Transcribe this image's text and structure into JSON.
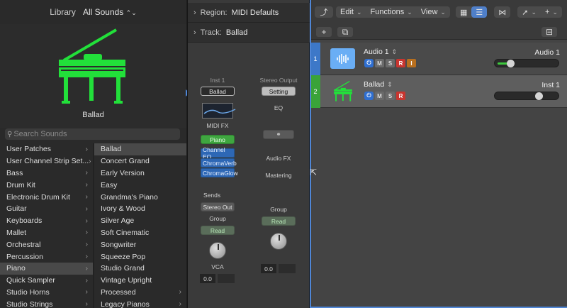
{
  "library": {
    "title": "Library",
    "selector": "All Sounds",
    "patch_name": "Ballad",
    "search_placeholder": "Search Sounds",
    "categories": [
      {
        "label": "User Patches",
        "selected": false
      },
      {
        "label": "User Channel Strip Set...",
        "selected": false
      },
      {
        "label": "Bass",
        "selected": false
      },
      {
        "label": "Drum Kit",
        "selected": false
      },
      {
        "label": "Electronic Drum Kit",
        "selected": false
      },
      {
        "label": "Guitar",
        "selected": false
      },
      {
        "label": "Keyboards",
        "selected": false
      },
      {
        "label": "Mallet",
        "selected": false
      },
      {
        "label": "Orchestral",
        "selected": false
      },
      {
        "label": "Percussion",
        "selected": false
      },
      {
        "label": "Piano",
        "selected": true
      },
      {
        "label": "Quick Sampler",
        "selected": false
      },
      {
        "label": "Studio Horns",
        "selected": false
      },
      {
        "label": "Studio Strings",
        "selected": false
      }
    ],
    "patches": [
      {
        "label": "Ballad",
        "selected": true,
        "folder": false
      },
      {
        "label": "Concert Grand",
        "selected": false,
        "folder": false
      },
      {
        "label": "Early Version",
        "selected": false,
        "folder": false
      },
      {
        "label": "Easy",
        "selected": false,
        "folder": false
      },
      {
        "label": "Grandma's Piano",
        "selected": false,
        "folder": false
      },
      {
        "label": "Ivory & Wood",
        "selected": false,
        "folder": false
      },
      {
        "label": "Silver Age",
        "selected": false,
        "folder": false
      },
      {
        "label": "Soft Cinematic",
        "selected": false,
        "folder": false
      },
      {
        "label": "Songwriter",
        "selected": false,
        "folder": false
      },
      {
        "label": "Squeeze Pop",
        "selected": false,
        "folder": false
      },
      {
        "label": "Studio Grand",
        "selected": false,
        "folder": false
      },
      {
        "label": "Vintage Upright",
        "selected": false,
        "folder": false
      },
      {
        "label": "Processed",
        "selected": false,
        "folder": true
      },
      {
        "label": "Legacy Pianos",
        "selected": false,
        "folder": true
      }
    ]
  },
  "inspector": {
    "region_key": "Region:",
    "region_value": "MIDI Defaults",
    "track_key": "Track:",
    "track_value": "Ballad",
    "strip_inst": {
      "name": "Inst 1",
      "setting": "Ballad",
      "midi_fx": "MIDI FX",
      "instrument": "Piano",
      "plugins": [
        "Channel EQ",
        "ChromaVerb",
        "ChromaGlow"
      ],
      "sends": "Sends",
      "output": "Stereo Out",
      "group": "Group",
      "automation": "Read",
      "vca": "VCA",
      "volume": "0.0"
    },
    "strip_out": {
      "name": "Stereo Output",
      "setting": "Setting",
      "eq": "EQ",
      "audio_fx": "Audio FX",
      "mastering": "Mastering",
      "group": "Group",
      "automation": "Read",
      "volume": "0.0"
    }
  },
  "toolbar": {
    "edit": "Edit",
    "functions": "Functions",
    "view": "View"
  },
  "tracks": [
    {
      "number": "1",
      "name": "Audio 1",
      "output": "Audio 1",
      "has_input": true,
      "level": 0.2
    },
    {
      "number": "2",
      "name": "Ballad",
      "output": "Inst 1",
      "has_input": false,
      "level": 0.72
    }
  ],
  "colors": {
    "accent_blue": "#3d78c8",
    "track_green": "#3aa33a",
    "piano_green": "#22e03a",
    "record_red": "#c9352f"
  }
}
